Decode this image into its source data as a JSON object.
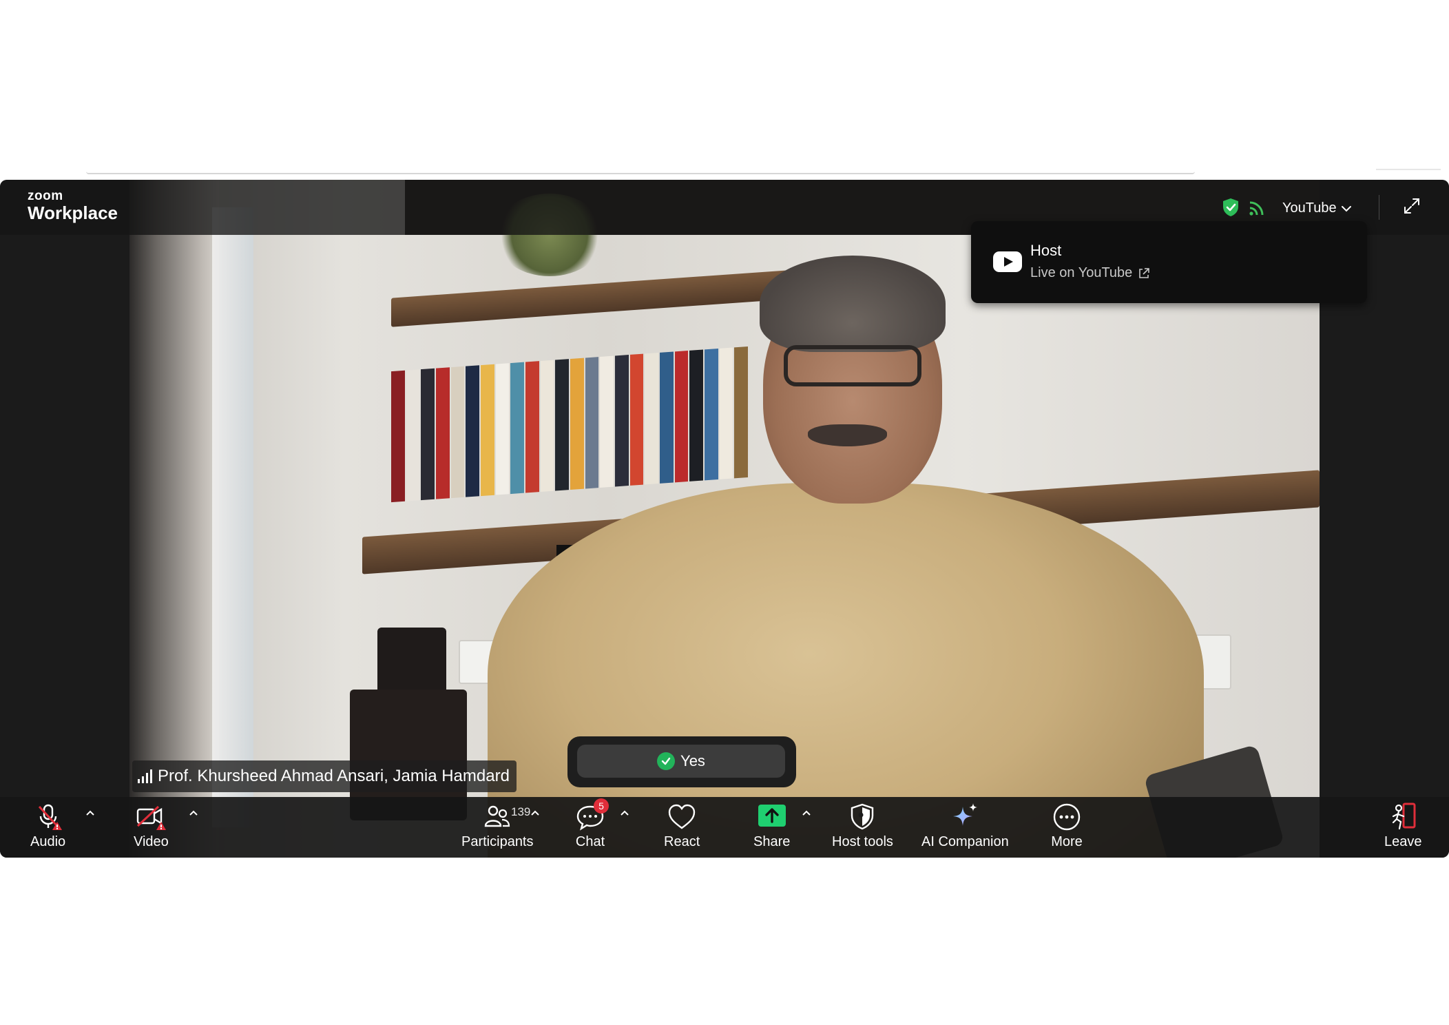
{
  "app": {
    "logo_small": "zoom",
    "logo_big": "Workplace"
  },
  "header": {
    "stream_dropdown_label": "YouTube",
    "colors": {
      "security_shield": "#2ebd59",
      "stream_bars": "#3fbf5a"
    }
  },
  "live_popover": {
    "title": "Host",
    "subtitle": "Live on YouTube"
  },
  "video": {
    "participant_name": "Prof. Khursheed Ahmad Ansari, Jamia Hamdard"
  },
  "poll_response": {
    "label": "Yes"
  },
  "toolbar": {
    "audio_label": "Audio",
    "video_label": "Video",
    "participants_label": "Participants",
    "participants_count": "139",
    "chat_label": "Chat",
    "chat_badge": "5",
    "react_label": "React",
    "share_label": "Share",
    "host_tools_label": "Host tools",
    "ai_companion_label": "AI Companion",
    "more_label": "More",
    "leave_label": "Leave",
    "colors": {
      "share_accent": "#1fcf70",
      "warning": "#e02e3a",
      "leave_accent": "#e02e3a"
    }
  }
}
